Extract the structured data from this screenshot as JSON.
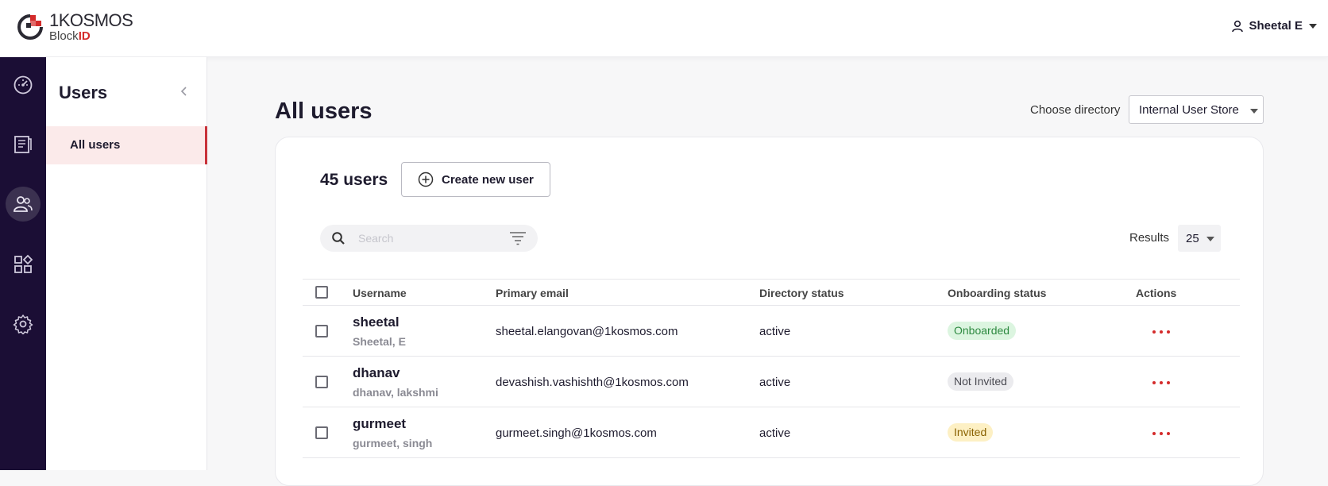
{
  "header": {
    "logo_main": "1KOSMOS",
    "logo_sub_prefix": "Block",
    "logo_sub_suffix": "ID",
    "user_name": "Sheetal E"
  },
  "rail": [
    {
      "icon": "dashboard-icon",
      "active": false
    },
    {
      "icon": "report-icon",
      "active": false
    },
    {
      "icon": "users-icon",
      "active": true
    },
    {
      "icon": "apps-icon",
      "active": false
    },
    {
      "icon": "settings-icon",
      "active": false
    }
  ],
  "subnav": {
    "title": "Users",
    "items": [
      {
        "label": "All users",
        "active": true
      }
    ]
  },
  "main": {
    "title": "All users",
    "directory_label": "Choose directory",
    "directory_value": "Internal User Store",
    "user_count": "45 users",
    "create_button": "Create new user",
    "search_placeholder": "Search",
    "results_label": "Results",
    "results_value": "25"
  },
  "table": {
    "columns": [
      "Username",
      "Primary email",
      "Directory status",
      "Onboarding status",
      "Actions"
    ],
    "rows": [
      {
        "username": "sheetal",
        "full_name": "Sheetal, E",
        "email": "sheetal.elangovan@1kosmos.com",
        "directory_status": "active",
        "onboarding_status": "Onboarded"
      },
      {
        "username": "dhanav",
        "full_name": "dhanav, lakshmi",
        "email": "devashish.vashishth@1kosmos.com",
        "directory_status": "active",
        "onboarding_status": "Not Invited"
      },
      {
        "username": "gurmeet",
        "full_name": "gurmeet, singh",
        "email": "gurmeet.singh@1kosmos.com",
        "directory_status": "active",
        "onboarding_status": "Invited"
      }
    ]
  },
  "colors": {
    "rail_bg": "#1b0e35",
    "accent": "#c8323a",
    "onboarded": "#2e8a41",
    "invited": "#8a6200"
  }
}
